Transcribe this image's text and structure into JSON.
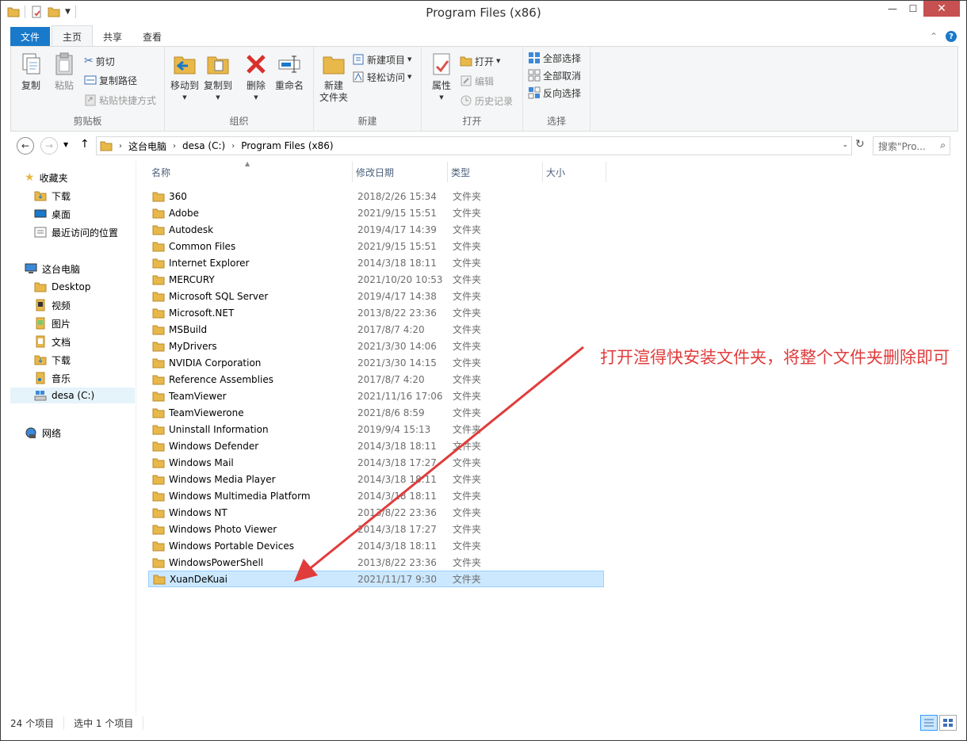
{
  "window": {
    "title": "Program Files (x86)"
  },
  "ribbon_tabs": [
    {
      "label": "文件"
    },
    {
      "label": "主页"
    },
    {
      "label": "共享"
    },
    {
      "label": "查看"
    }
  ],
  "ribbon": {
    "clipboard": {
      "label": "剪贴板",
      "copy": "复制",
      "paste": "粘贴",
      "cut": "剪切",
      "copy_path": "复制路径",
      "paste_shortcut": "粘贴快捷方式"
    },
    "organize": {
      "label": "组织",
      "move_to": "移动到",
      "copy_to": "复制到",
      "delete": "删除",
      "rename": "重命名"
    },
    "new": {
      "label": "新建",
      "new_folder_line1": "新建",
      "new_folder_line2": "文件夹",
      "new_item": "新建项目",
      "easy_access": "轻松访问"
    },
    "open": {
      "label": "打开",
      "properties": "属性",
      "open": "打开",
      "edit": "编辑",
      "history": "历史记录"
    },
    "select": {
      "label": "选择",
      "select_all": "全部选择",
      "select_none": "全部取消",
      "invert": "反向选择"
    }
  },
  "address": {
    "crumbs": [
      "这台电脑",
      "desa (C:)",
      "Program Files (x86)"
    ],
    "search_placeholder": "搜索\"Pro..."
  },
  "nav": {
    "favorites": "收藏夹",
    "fav_items": [
      "下载",
      "桌面",
      "最近访问的位置"
    ],
    "this_pc": "这台电脑",
    "pc_items": [
      "Desktop",
      "视频",
      "图片",
      "文档",
      "下载",
      "音乐",
      "desa (C:)"
    ],
    "network": "网络"
  },
  "columns": {
    "name": "名称",
    "date": "修改日期",
    "type": "类型",
    "size": "大小"
  },
  "files": [
    {
      "name": "360",
      "date": "2018/2/26 15:34",
      "type": "文件夹"
    },
    {
      "name": "Adobe",
      "date": "2021/9/15 15:51",
      "type": "文件夹"
    },
    {
      "name": "Autodesk",
      "date": "2019/4/17 14:39",
      "type": "文件夹"
    },
    {
      "name": "Common Files",
      "date": "2021/9/15 15:51",
      "type": "文件夹"
    },
    {
      "name": "Internet Explorer",
      "date": "2014/3/18 18:11",
      "type": "文件夹"
    },
    {
      "name": "MERCURY",
      "date": "2021/10/20 10:53",
      "type": "文件夹"
    },
    {
      "name": "Microsoft SQL Server",
      "date": "2019/4/17 14:38",
      "type": "文件夹"
    },
    {
      "name": "Microsoft.NET",
      "date": "2013/8/22 23:36",
      "type": "文件夹"
    },
    {
      "name": "MSBuild",
      "date": "2017/8/7 4:20",
      "type": "文件夹"
    },
    {
      "name": "MyDrivers",
      "date": "2021/3/30 14:06",
      "type": "文件夹"
    },
    {
      "name": "NVIDIA Corporation",
      "date": "2021/3/30 14:15",
      "type": "文件夹"
    },
    {
      "name": "Reference Assemblies",
      "date": "2017/8/7 4:20",
      "type": "文件夹"
    },
    {
      "name": "TeamViewer",
      "date": "2021/11/16 17:06",
      "type": "文件夹"
    },
    {
      "name": "TeamViewerone",
      "date": "2021/8/6 8:59",
      "type": "文件夹"
    },
    {
      "name": "Uninstall Information",
      "date": "2019/9/4 15:13",
      "type": "文件夹"
    },
    {
      "name": "Windows Defender",
      "date": "2014/3/18 18:11",
      "type": "文件夹"
    },
    {
      "name": "Windows Mail",
      "date": "2014/3/18 17:27",
      "type": "文件夹"
    },
    {
      "name": "Windows Media Player",
      "date": "2014/3/18 18:11",
      "type": "文件夹"
    },
    {
      "name": "Windows Multimedia Platform",
      "date": "2014/3/18 18:11",
      "type": "文件夹"
    },
    {
      "name": "Windows NT",
      "date": "2013/8/22 23:36",
      "type": "文件夹"
    },
    {
      "name": "Windows Photo Viewer",
      "date": "2014/3/18 17:27",
      "type": "文件夹"
    },
    {
      "name": "Windows Portable Devices",
      "date": "2014/3/18 18:11",
      "type": "文件夹"
    },
    {
      "name": "WindowsPowerShell",
      "date": "2013/8/22 23:36",
      "type": "文件夹"
    },
    {
      "name": "XuanDeKuai",
      "date": "2021/11/17 9:30",
      "type": "文件夹",
      "selected": true
    }
  ],
  "annotation": "打开渲得快安装文件夹，将整个文件夹删除即可",
  "status": {
    "count": "24 个项目",
    "selected": "选中 1 个项目"
  },
  "colors": {
    "accent": "#1979ca",
    "selection": "#cce8ff",
    "annotation": "#e03c3c",
    "folder": "#e8b84a"
  }
}
